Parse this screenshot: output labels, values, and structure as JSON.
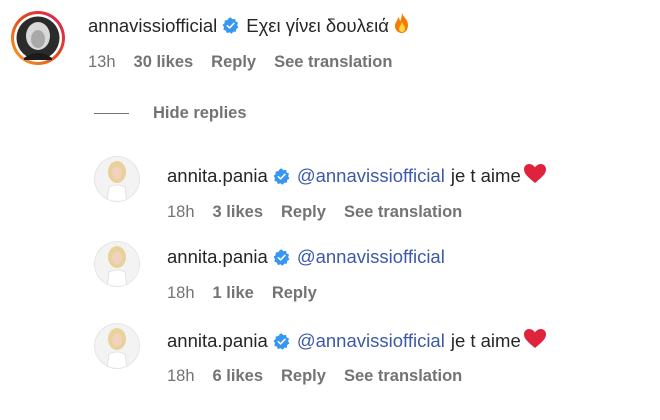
{
  "top_comment": {
    "username": "annavissiofficial",
    "text": "Εχει γίνει δουλειά",
    "emoji_icon": "fire-icon",
    "time": "13h",
    "likes": "30 likes",
    "reply": "Reply",
    "see_translation": "See translation"
  },
  "hide_replies": "Hide replies",
  "replies": [
    {
      "username": "annita.pania",
      "mention": "@annavissiofficial",
      "text": "je t aime",
      "emoji_icon": "heart-icon",
      "time": "18h",
      "likes": "3 likes",
      "reply": "Reply",
      "see_translation": "See translation"
    },
    {
      "username": "annita.pania",
      "mention": "@annavissiofficial",
      "text": "",
      "time": "18h",
      "likes": "1 like",
      "reply": "Reply"
    },
    {
      "username": "annita.pania",
      "mention": "@annavissiofficial",
      "text": "je t aime",
      "emoji_icon": "heart-icon",
      "time": "18h",
      "likes": "6 likes",
      "reply": "Reply",
      "see_translation": "See translation"
    }
  ],
  "colors": {
    "text": "#262626",
    "secondary": "#737373",
    "mention": "#3d5aa8",
    "verified_badge": "#3797f0",
    "heart": "#e0233c",
    "story_ring_start": "#f9a825",
    "story_ring_end": "#d81b60"
  }
}
